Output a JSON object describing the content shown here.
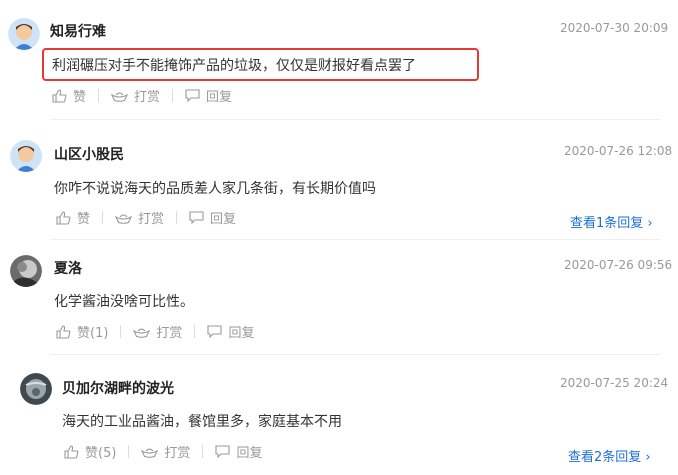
{
  "comments": [
    {
      "name": "知易行难",
      "time": "2020-07-30 20:09",
      "text": "利润碾压对手不能掩饰产品的垃圾，仅仅是财报好看点罢了",
      "like_label": "赞",
      "tip_label": "打赏",
      "reply_label": "回复",
      "highlighted": true
    },
    {
      "name": "山区小股民",
      "time": "2020-07-26 12:08",
      "text": "你咋不说说海天的品质差人家几条街，有长期价值吗",
      "like_label": "赞",
      "tip_label": "打赏",
      "reply_label": "回复",
      "view_replies": "查看1条回复 ›"
    },
    {
      "name": "夏洛",
      "time": "2020-07-26 09:56",
      "text": "化学酱油没啥可比性。",
      "like_label": "赞(1)",
      "tip_label": "打赏",
      "reply_label": "回复"
    },
    {
      "name": "贝加尔湖畔的波光",
      "time": "2020-07-25 20:24",
      "text": "海天的工业品酱油，餐馆里多，家庭基本不用",
      "like_label": "赞(5)",
      "tip_label": "打赏",
      "reply_label": "回复",
      "view_replies": "查看2条回复 ›"
    }
  ],
  "colors": {
    "highlight": "#e53935",
    "link": "#1e6fd9",
    "muted": "#999999"
  }
}
